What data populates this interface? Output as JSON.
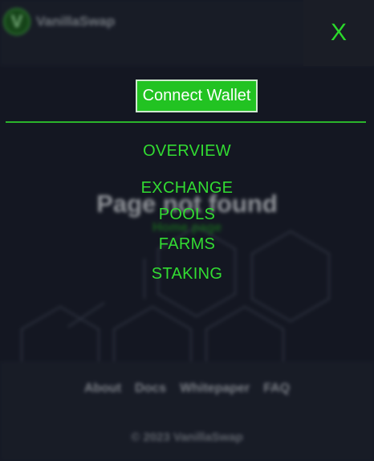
{
  "header": {
    "logo_text": "VanillaSwap",
    "logo_mark": "V",
    "close_label": "X"
  },
  "menu": {
    "connect_wallet_label": "Connect Wallet",
    "items": [
      {
        "label": "OVERVIEW"
      },
      {
        "label": "EXCHANGE"
      },
      {
        "label": "POOLS"
      },
      {
        "label": "FARMS"
      },
      {
        "label": "STAKING"
      }
    ]
  },
  "main": {
    "not_found_title": "Page not found",
    "home_link": "Home page"
  },
  "footer": {
    "links": [
      {
        "label": "About"
      },
      {
        "label": "Docs"
      },
      {
        "label": "Whitepaper"
      },
      {
        "label": "FAQ"
      }
    ],
    "copyright": "© 2023 VanillaSwap"
  },
  "icons": {
    "close": "close-icon",
    "logo": "vanillaswap-logo-icon",
    "background": "hexagon-pattern"
  },
  "colors": {
    "accent": "#32dc32",
    "button_bg": "#22c322",
    "background": "#1b1e2b"
  }
}
